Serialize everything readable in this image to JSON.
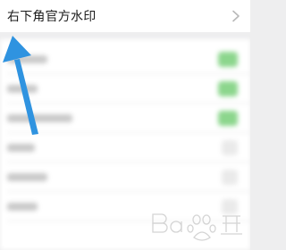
{
  "setting_row": {
    "label": "右下角官方水印"
  },
  "blurred_rows": [
    {
      "label_width": 0.16,
      "toggle": "on"
    },
    {
      "label_width": 0.12,
      "toggle": "on"
    },
    {
      "label_width": 0.26,
      "toggle": "on"
    },
    {
      "label_width": 0.11,
      "toggle": "off"
    },
    {
      "label_width": 0.16,
      "toggle": "off"
    },
    {
      "label_width": 0.12,
      "toggle": "off"
    }
  ],
  "colors": {
    "arrow": "#2f93e0",
    "toggle_on": "#8cd68d",
    "background": "#eeeeef"
  },
  "icons": {
    "chevron": "chevron-right-icon",
    "annotation": "arrow-up-icon",
    "watermark": "baidu-jingyan-watermark"
  }
}
